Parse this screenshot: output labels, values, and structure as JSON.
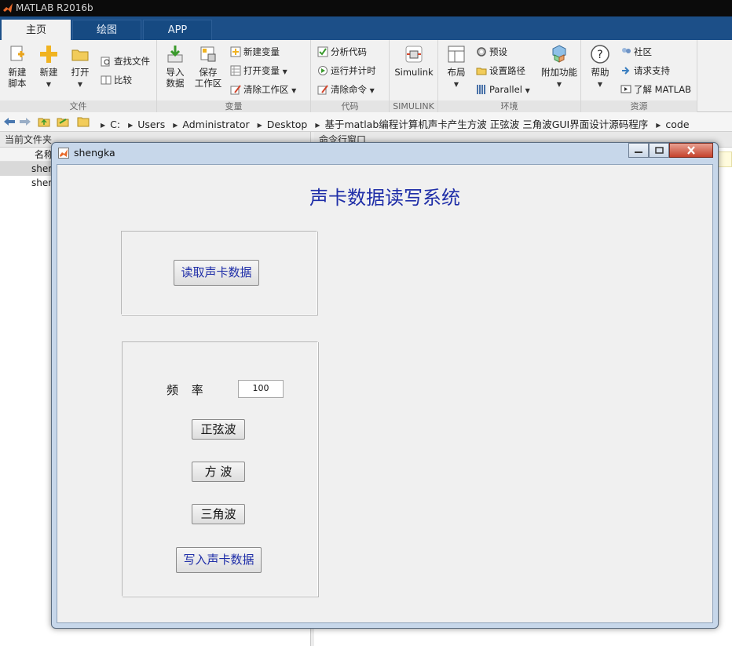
{
  "app": {
    "title": "MATLAB R2016b"
  },
  "tabs": [
    {
      "label": "主页",
      "active": true
    },
    {
      "label": "绘图",
      "active": false
    },
    {
      "label": "APP",
      "active": false
    }
  ],
  "ribbon": {
    "file": {
      "label": "文件",
      "new_script": "新建\n脚本",
      "new": "新建",
      "open": "打开",
      "find_files": "查找文件",
      "compare": "比较"
    },
    "variable": {
      "label": "变量",
      "import": "导入\n数据",
      "save": "保存\n工作区",
      "new_var": "新建变量",
      "open_var": "打开变量",
      "clear_ws": "清除工作区"
    },
    "code": {
      "label": "代码",
      "analyze": "分析代码",
      "run_time": "运行并计时",
      "clear_cmd": "清除命令"
    },
    "simulink": {
      "label": "SIMULINK",
      "simulink": "Simulink"
    },
    "env": {
      "label": "环境",
      "layout": "布局",
      "prefs": "预设",
      "set_path": "设置路径",
      "parallel": "Parallel",
      "addons": "附加功能"
    },
    "resources": {
      "label": "资源",
      "help": "帮助",
      "community": "社区",
      "support": "请求支持",
      "learn": "了解 MATLAB"
    }
  },
  "address": {
    "crumbs": [
      "C:",
      "Users",
      "Administrator",
      "Desktop",
      "基于matlab编程计算机声卡产生方波 正弦波 三角波GUI界面设计源码程序",
      "code"
    ]
  },
  "left_panel": {
    "header": "当前文件夹",
    "column": "名称",
    "files": [
      "sher",
      "sher"
    ]
  },
  "right_panel": {
    "header": "命令行窗口"
  },
  "figure": {
    "title": "shengka",
    "heading": "声卡数据读写系统",
    "read_button": "读取声卡数据",
    "freq_label": "频 率",
    "freq_value": "100",
    "sine_button": "正弦波",
    "square_button": "方 波",
    "triangle_button": "三角波",
    "write_button": "写入声卡数据"
  },
  "colors": {
    "accent": "#1f2ea8",
    "tab_bar": "#1c4f88"
  }
}
